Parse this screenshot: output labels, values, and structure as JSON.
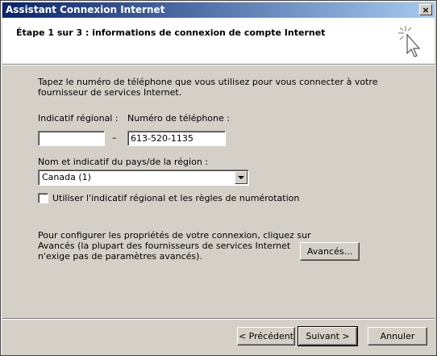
{
  "window": {
    "title": "Assistant Connexion Internet",
    "close_glyph": "×"
  },
  "header": {
    "title": "Étape 1 sur 3 : informations de connexion de compte Internet",
    "icon": "cursor-sparkle-icon"
  },
  "main": {
    "intro_line1": "Tapez le numéro de téléphone que vous utilisez pour vous connecter à votre",
    "intro_line2": "fournisseur de services Internet.",
    "area_code_label": "Indicatif régional :",
    "area_code_value": "",
    "dash": "–",
    "phone_label": "Numéro de téléphone :",
    "phone_value": "613-520-1135",
    "country_label": "Nom et indicatif du pays/de la région :",
    "country_value": "Canada (1)",
    "checkbox_label": "Utiliser l'indicatif régional et les règles de numérotation",
    "checkbox_checked": false,
    "advanced_line1": "Pour configurer les propriétés de votre connexion, cliquez sur",
    "advanced_line2": "Avancés (la plupart des fournisseurs de services Internet",
    "advanced_line3": "n'exige pas de paramètres avancés).",
    "advanced_button": "Avancés..."
  },
  "footer": {
    "back_button": "< Précédent",
    "next_button": "Suivant >",
    "cancel_button": "Annuler"
  }
}
